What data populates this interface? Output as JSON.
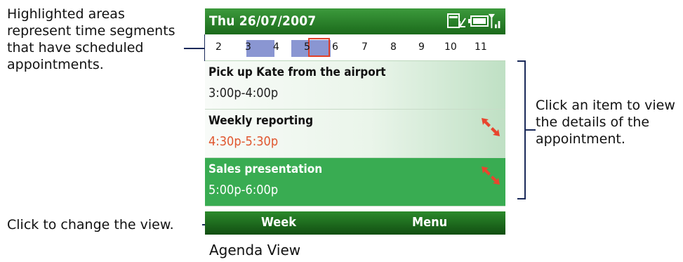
{
  "annotations": {
    "left": "Highlighted areas represent time segments that have scheduled appointments.",
    "right": "Click an item to view the details of the appointment.",
    "bottom": "Click to change the view."
  },
  "caption": "Agenda View",
  "phone": {
    "title": "Thu 26/07/2007",
    "status_icons": [
      "calendar-alert-icon",
      "battery-icon",
      "signal-icon"
    ],
    "hours": [
      "2",
      "3",
      "4",
      "5",
      "6",
      "7",
      "8",
      "9",
      "10",
      "11"
    ],
    "appointments": [
      {
        "title": "Pick up Kate from the airport",
        "time": "3:00p-4:00p",
        "conflict": false,
        "selected": false
      },
      {
        "title": "Weekly reporting",
        "time": "4:30p-5:30p",
        "conflict": true,
        "selected": false
      },
      {
        "title": "Sales presentation",
        "time": "5:00p-6:00p",
        "conflict": true,
        "selected": true
      }
    ],
    "softkeys": {
      "left": "Week",
      "right": "Menu"
    }
  },
  "colors": {
    "accent_green": "#2b8a2b",
    "busy_block": "#8a96d2",
    "conflict": "#e0562e",
    "selected": "#39ac52"
  }
}
